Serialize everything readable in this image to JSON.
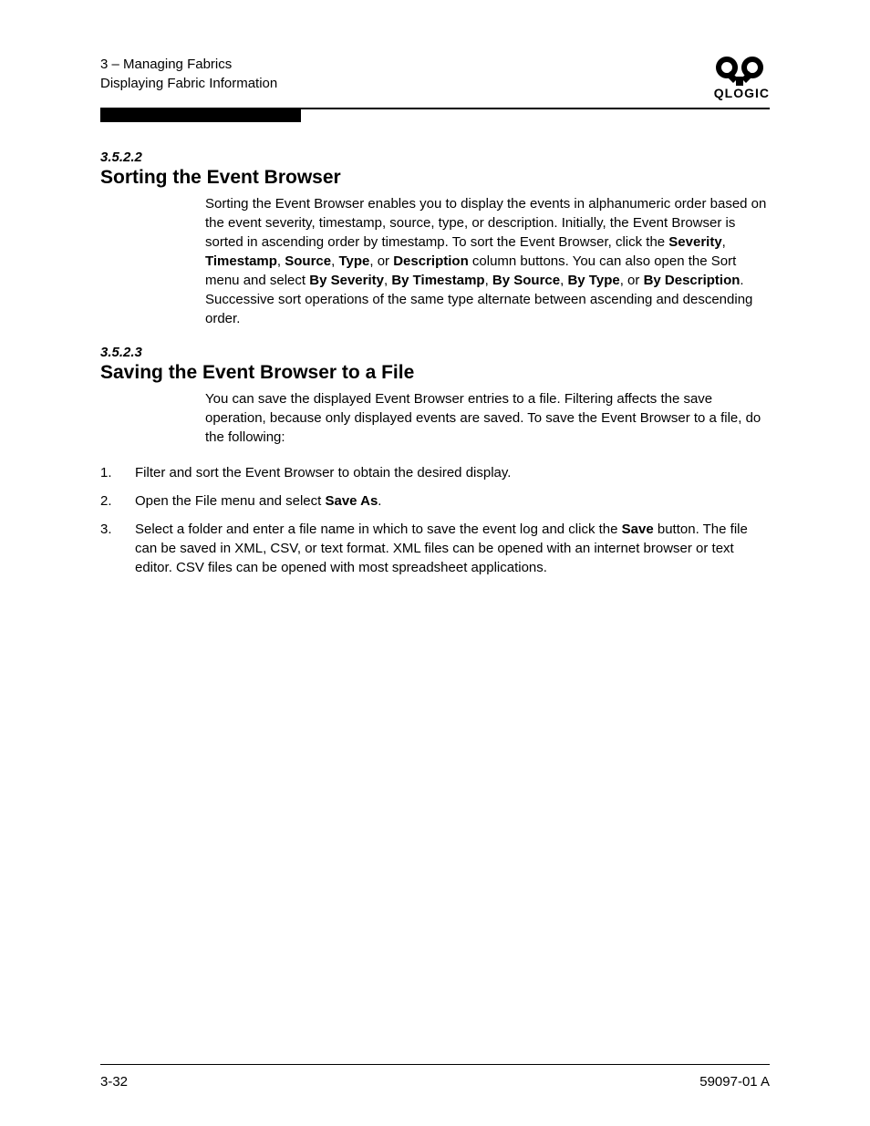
{
  "header": {
    "chapter_line": "3 – Managing Fabrics",
    "section_line": "Displaying Fabric Information",
    "brand": "QLOGIC"
  },
  "sections": [
    {
      "num": "3.5.2.2",
      "title": "Sorting the Event Browser",
      "para_parts": [
        {
          "t": "Sorting the Event Browser enables you to display the events in alphanumeric order based on the event severity, timestamp, source, type, or description. Initially, the Event Browser is sorted in ascending order by timestamp. To sort the Event Browser, click the "
        },
        {
          "t": "Severity",
          "b": true
        },
        {
          "t": ", "
        },
        {
          "t": "Timestamp",
          "b": true
        },
        {
          "t": ", "
        },
        {
          "t": "Source",
          "b": true
        },
        {
          "t": ", "
        },
        {
          "t": "Type",
          "b": true
        },
        {
          "t": ", or "
        },
        {
          "t": "Description",
          "b": true
        },
        {
          "t": " column buttons. You can also open the Sort menu and select "
        },
        {
          "t": "By Severity",
          "b": true
        },
        {
          "t": ", "
        },
        {
          "t": "By Timestamp",
          "b": true
        },
        {
          "t": ", "
        },
        {
          "t": "By Source",
          "b": true
        },
        {
          "t": ", "
        },
        {
          "t": "By Type",
          "b": true
        },
        {
          "t": ", or "
        },
        {
          "t": "By Description",
          "b": true
        },
        {
          "t": ". Successive sort operations of the same type alternate between ascending and descending order."
        }
      ]
    },
    {
      "num": "3.5.2.3",
      "title": "Saving the Event Browser to a File",
      "para_parts": [
        {
          "t": "You can save the displayed Event Browser entries to a file. Filtering affects the save operation, because only displayed events are saved. To save the Event Browser to a file, do the following:"
        }
      ],
      "steps": [
        [
          {
            "t": "Filter and sort the Event Browser to obtain the desired display."
          }
        ],
        [
          {
            "t": "Open the File menu and select "
          },
          {
            "t": "Save As",
            "b": true
          },
          {
            "t": "."
          }
        ],
        [
          {
            "t": "Select a folder and enter a file name in which to save the event log and click the "
          },
          {
            "t": "Save",
            "b": true
          },
          {
            "t": " button. The file can be saved in XML, CSV, or text format. XML files can be opened with an internet browser or text editor. CSV files can be opened with most spreadsheet applications."
          }
        ]
      ]
    }
  ],
  "footer": {
    "left": "3-32",
    "right": "59097-01 A"
  }
}
